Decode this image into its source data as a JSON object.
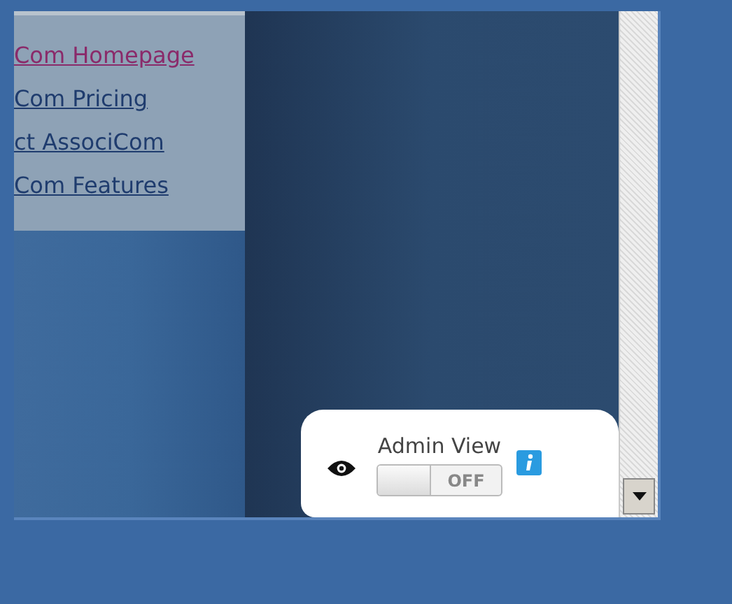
{
  "links": [
    {
      "label": "Com Homepage",
      "visited": true
    },
    {
      "label": "Com Pricing",
      "visited": false
    },
    {
      "label": "ct AssociCom",
      "visited": false
    },
    {
      "label": "Com Features",
      "visited": false
    }
  ],
  "admin_view": {
    "label": "Admin View",
    "toggle": {
      "on": false,
      "text": "OFF"
    }
  }
}
